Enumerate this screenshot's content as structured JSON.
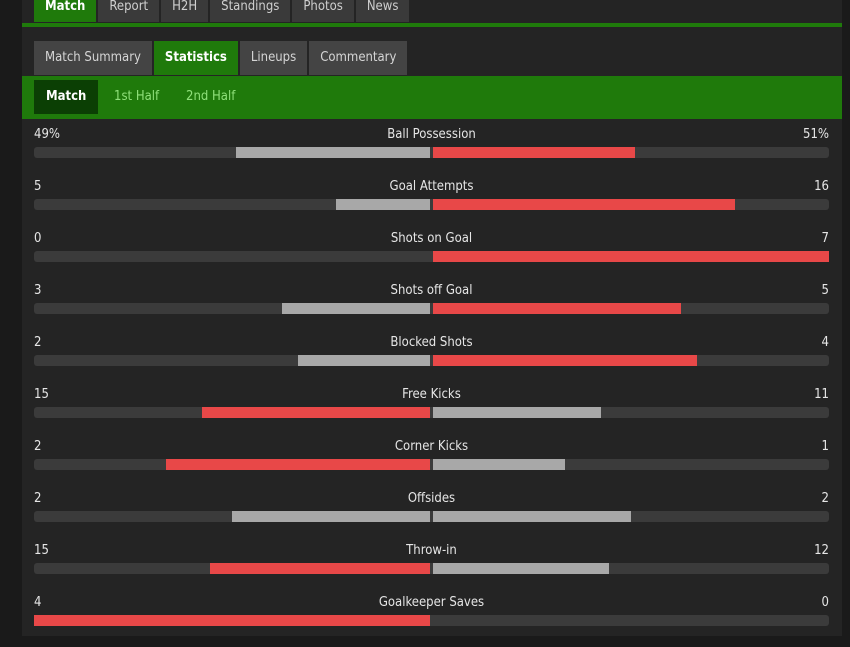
{
  "top_tabs": [
    {
      "label": "Match",
      "active": true
    },
    {
      "label": "Report"
    },
    {
      "label": "H2H"
    },
    {
      "label": "Standings"
    },
    {
      "label": "Photos"
    },
    {
      "label": "News"
    }
  ],
  "sub_tabs": [
    {
      "label": "Match Summary"
    },
    {
      "label": "Statistics",
      "active": true
    },
    {
      "label": "Lineups"
    },
    {
      "label": "Commentary"
    }
  ],
  "periods": [
    {
      "label": "Match",
      "active": true
    },
    {
      "label": "1st Half"
    },
    {
      "label": "2nd Half"
    }
  ],
  "colors": {
    "accent": "#1f7a0b",
    "leader": "#e84848",
    "other": "#a8a8a8",
    "track": "#3b3b3b"
  },
  "stats": [
    {
      "name": "Ball Possession",
      "home": "49%",
      "away": "51%",
      "home_val": 49,
      "away_val": 51
    },
    {
      "name": "Goal Attempts",
      "home": "5",
      "away": "16",
      "home_val": 5,
      "away_val": 16
    },
    {
      "name": "Shots on Goal",
      "home": "0",
      "away": "7",
      "home_val": 0,
      "away_val": 7
    },
    {
      "name": "Shots off Goal",
      "home": "3",
      "away": "5",
      "home_val": 3,
      "away_val": 5
    },
    {
      "name": "Blocked Shots",
      "home": "2",
      "away": "4",
      "home_val": 2,
      "away_val": 4
    },
    {
      "name": "Free Kicks",
      "home": "15",
      "away": "11",
      "home_val": 15,
      "away_val": 11
    },
    {
      "name": "Corner Kicks",
      "home": "2",
      "away": "1",
      "home_val": 2,
      "away_val": 1
    },
    {
      "name": "Offsides",
      "home": "2",
      "away": "2",
      "home_val": 2,
      "away_val": 2
    },
    {
      "name": "Throw-in",
      "home": "15",
      "away": "12",
      "home_val": 15,
      "away_val": 12
    },
    {
      "name": "Goalkeeper Saves",
      "home": "4",
      "away": "0",
      "home_val": 4,
      "away_val": 0
    }
  ]
}
